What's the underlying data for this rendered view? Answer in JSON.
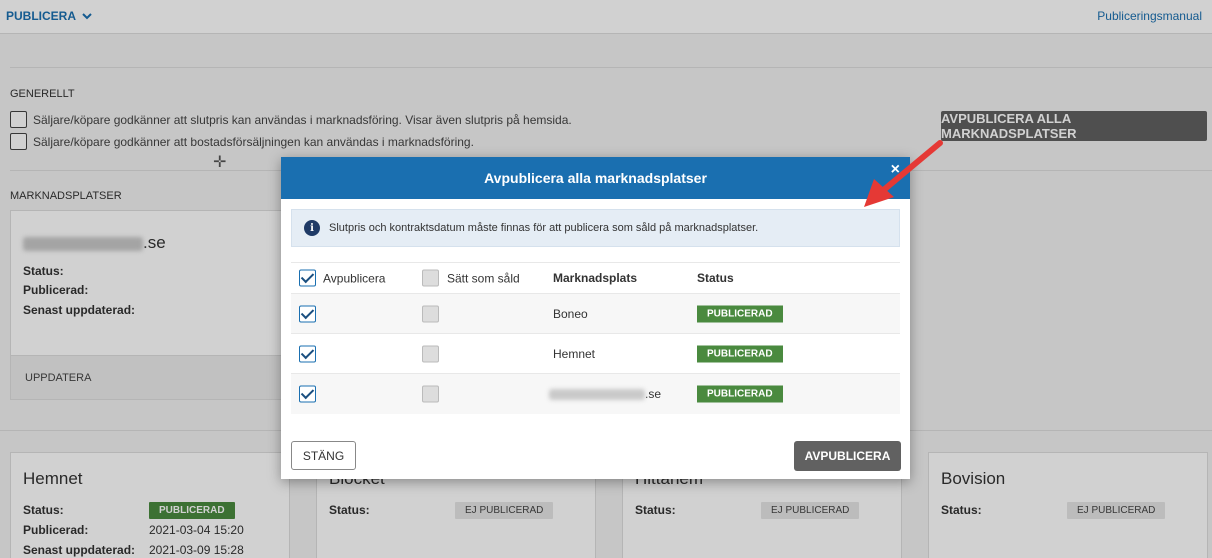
{
  "header": {
    "dropdown_label": "PUBLICERA",
    "manual_link": "Publiceringsmanual"
  },
  "general": {
    "title": "GENERELLT",
    "checkbox1": "Säljare/köpare godkänner att slutpris kan användas i marknadsföring. Visar även slutpris på hemsida.",
    "checkbox2": "Säljare/köpare godkänner att bostadsförsäljningen kan användas i marknadsföring.",
    "unpublish_all_button": "AVPUBLICERA ALLA MARKNADSPLATSER"
  },
  "marketplaces_section": {
    "title": "MARKNADSPLATSER",
    "top_card": {
      "title_suffix": ".se",
      "status_label": "Status:",
      "published_label": "Publicerad:",
      "updated_label": "Senast uppdaterad:",
      "footer_button": "UPPDATERA"
    },
    "cards": [
      {
        "title": "Hemnet",
        "status_label": "Status:",
        "status": "PUBLICERAD",
        "published_label": "Publicerad:",
        "published": "2021-03-04 15:20",
        "updated_label": "Senast uppdaterad:",
        "updated": "2021-03-09 15:28"
      },
      {
        "title": "Blocket",
        "status_label": "Status:",
        "status": "EJ PUBLICERAD"
      },
      {
        "title": "Hittahem",
        "status_label": "Status:",
        "status": "EJ PUBLICERAD"
      },
      {
        "title": "Bovision",
        "status_label": "Status:",
        "status": "EJ PUBLICERAD"
      }
    ]
  },
  "modal": {
    "title": "Avpublicera alla marknadsplatser",
    "close_glyph": "×",
    "info_text": "Slutpris och kontraktsdatum måste finnas för att publicera som såld på marknadsplatser.",
    "columns": {
      "unpublish": "Avpublicera",
      "mark_sold": "Sätt som såld",
      "marketplace": "Marknadsplats",
      "status": "Status"
    },
    "rows": [
      {
        "marketplace": "Boneo",
        "status": "PUBLICERAD"
      },
      {
        "marketplace": "Hemnet",
        "status": "PUBLICERAD"
      },
      {
        "marketplace_suffix": ".se",
        "status": "PUBLICERAD"
      }
    ],
    "close_button": "STÄNG",
    "unpublish_button": "AVPUBLICERA"
  },
  "colors": {
    "accent": "#1a6fb0",
    "published": "#4a8a3f",
    "dark_button": "#616161",
    "arrow": "#e53935"
  }
}
